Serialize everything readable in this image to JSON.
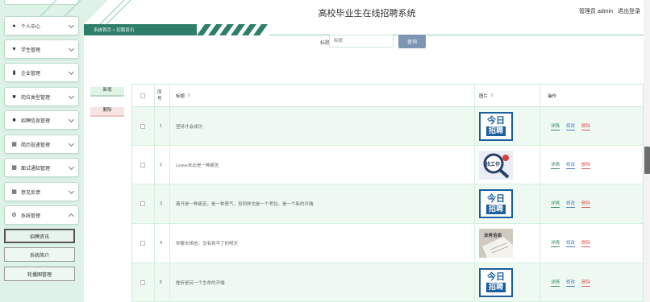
{
  "header": {
    "title": "高校毕业生在线招聘系统",
    "user": "管理员 admin",
    "logout": "退出登录"
  },
  "breadcrumb": "系统首页 > 招聘资讯",
  "search": {
    "label": "标题",
    "placeholder": "标题",
    "button": "查询"
  },
  "actions": {
    "add": "新增",
    "delete": "删除"
  },
  "sidebar": {
    "items": [
      {
        "label": "个人中心",
        "icon": "person-icon"
      },
      {
        "label": "学生管理",
        "icon": "student-icon"
      },
      {
        "label": "企业管理",
        "icon": "chart-icon"
      },
      {
        "label": "岗位类型管理",
        "icon": "briefcase-icon"
      },
      {
        "label": "招聘信息管理",
        "icon": "clipboard-icon"
      },
      {
        "label": "简历投递管理",
        "icon": "grid-icon"
      },
      {
        "label": "面试通知管理",
        "icon": "grid-icon"
      },
      {
        "label": "意见反馈",
        "icon": "grid-icon"
      },
      {
        "label": "系统管理",
        "icon": "settings-icon"
      }
    ],
    "sub_items": [
      {
        "label": "招聘资讯"
      },
      {
        "label": "系统简介"
      },
      {
        "label": "轮播图管理"
      }
    ]
  },
  "table": {
    "columns": {
      "index": "序号",
      "title": "标题",
      "image": "图片",
      "ops": "操作"
    },
    "op_labels": {
      "detail": "详情",
      "edit": "修改",
      "delete": "删除"
    },
    "rows": [
      {
        "index": "1",
        "title": "坚持才会成功",
        "image": "today-hiring"
      },
      {
        "index": "2",
        "title": "Leave未必是一种痛苦",
        "image": "search-hiring"
      },
      {
        "index": "3",
        "title": "离开是一种痛苦，是一种勇气，但同样也是一个考验，是一个新的开端",
        "image": "today-hiring"
      },
      {
        "index": "4",
        "title": "你要去相信，没有到不了的明天",
        "image": "work-photo"
      },
      {
        "index": "5",
        "title": "挫折是另一个生命的开端",
        "image": "today-hiring"
      }
    ]
  },
  "thumb_text": {
    "today_line1": "今日",
    "today_line2": "招聘",
    "search_text": "找工作",
    "work_text": "业务洽谈"
  },
  "colors": {
    "accent": "#2f7e6a",
    "sidebar_bg": "#dff2e8",
    "search_button": "#7d95b2",
    "detail": "#3a8c66",
    "edit": "#4b79c2",
    "delete": "#e05a5a"
  }
}
